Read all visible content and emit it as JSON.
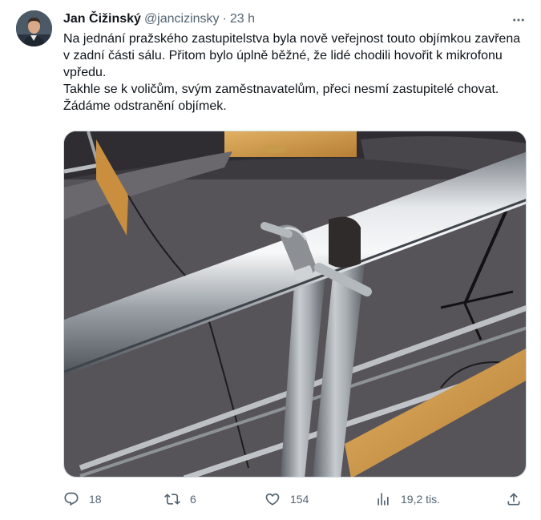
{
  "author": {
    "name": "Jan Čižinský",
    "handle": "@jancizinsky",
    "separator": "·",
    "time": "23 h"
  },
  "tweet": {
    "paragraphs": [
      "Na jednání pražského zastupitelstva byla nově veřejnost touto objímkou zavřena v zadní části sálu.  Přitom bylo úplně běžné,  že lidé chodili hovořit k mikrofonu vpředu.",
      "Takhle se k voličům,  svým zaměstnavatelům, přeci nesmí zastupitelé chovat. Žádáme odstranění objímek."
    ]
  },
  "actions": {
    "replies": "18",
    "reposts": "6",
    "likes": "154",
    "views": "19,2 tis."
  },
  "icons": {
    "more": "more-dots-icon",
    "reply": "reply-icon",
    "repost": "repost-icon",
    "like": "heart-icon",
    "views": "views-icon",
    "share": "share-icon"
  },
  "colors": {
    "text": "#0f1419",
    "secondary": "#536471",
    "border": "#cfd9de"
  }
}
